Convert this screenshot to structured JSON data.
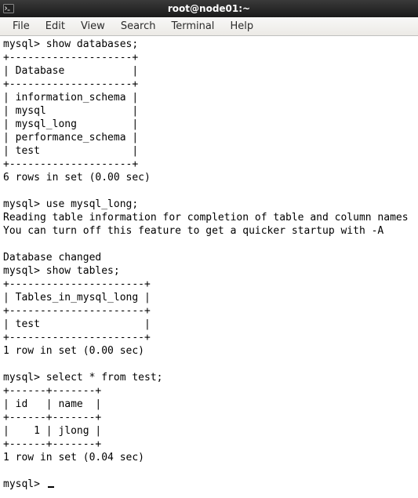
{
  "window": {
    "title": "root@node01:~"
  },
  "menubar": {
    "items": [
      "File",
      "Edit",
      "View",
      "Search",
      "Terminal",
      "Help"
    ]
  },
  "terminal": {
    "lines": [
      "mysql> show databases;",
      "+--------------------+",
      "| Database           |",
      "+--------------------+",
      "| information_schema |",
      "| mysql              |",
      "| mysql_long         |",
      "| performance_schema |",
      "| test               |",
      "+--------------------+",
      "6 rows in set (0.00 sec)",
      "",
      "mysql> use mysql_long;",
      "Reading table information for completion of table and column names",
      "You can turn off this feature to get a quicker startup with -A",
      "",
      "Database changed",
      "mysql> show tables;",
      "+----------------------+",
      "| Tables_in_mysql_long |",
      "+----------------------+",
      "| test                 |",
      "+----------------------+",
      "1 row in set (0.00 sec)",
      "",
      "mysql> select * from test;",
      "+------+-------+",
      "| id   | name  |",
      "+------+-------+",
      "|    1 | jlong |",
      "+------+-------+",
      "1 row in set (0.04 sec)",
      "",
      "mysql> "
    ]
  }
}
